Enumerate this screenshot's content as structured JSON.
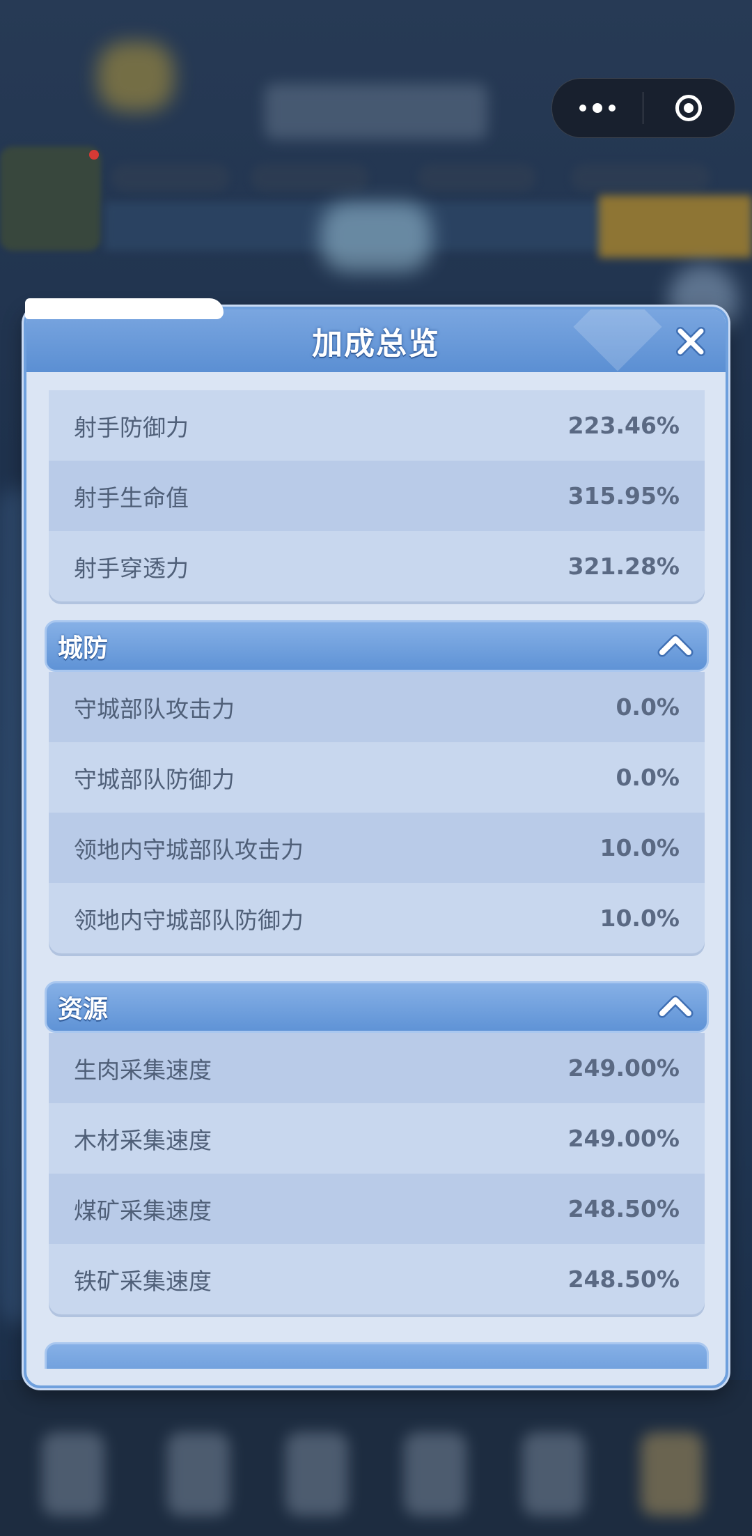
{
  "modal": {
    "title": "加成总览"
  },
  "sections": [
    {
      "rows": [
        {
          "label": "射手防御力",
          "value": "223.46%"
        },
        {
          "label": "射手生命值",
          "value": "315.95%"
        },
        {
          "label": "射手穿透力",
          "value": "321.28%"
        }
      ]
    },
    {
      "title": "城防",
      "rows": [
        {
          "label": "守城部队攻击力",
          "value": "0.0%"
        },
        {
          "label": "守城部队防御力",
          "value": "0.0%"
        },
        {
          "label": "领地内守城部队攻击力",
          "value": "10.0%"
        },
        {
          "label": "领地内守城部队防御力",
          "value": "10.0%"
        }
      ]
    },
    {
      "title": "资源",
      "rows": [
        {
          "label": "生肉采集速度",
          "value": "249.00%"
        },
        {
          "label": "木材采集速度",
          "value": "249.00%"
        },
        {
          "label": "煤矿采集速度",
          "value": "248.50%"
        },
        {
          "label": "铁矿采集速度",
          "value": "248.50%"
        }
      ]
    }
  ],
  "icons": {
    "close": "close-icon",
    "collapse": "chevron-up-icon",
    "more": "more-dots-icon",
    "exit": "target-circle-icon"
  },
  "colors": {
    "header_blue": "#5f93d6",
    "panel_bg": "#dbe5f4",
    "row_light": "#c8d7ee",
    "row_dark": "#b9cbe8",
    "text": "#4f5f78"
  }
}
